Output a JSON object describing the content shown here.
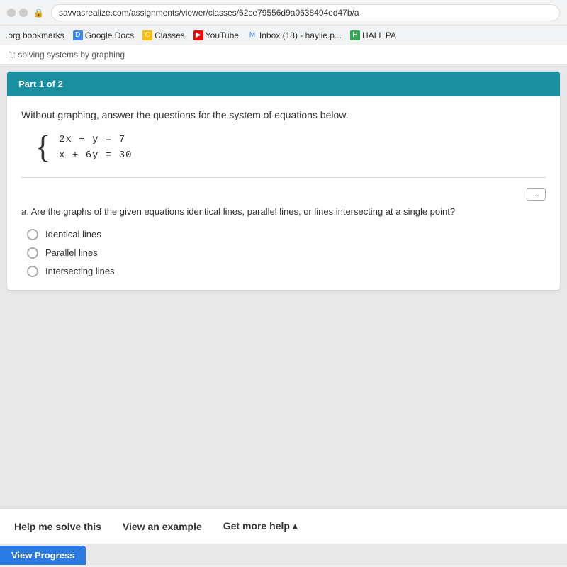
{
  "browser": {
    "url": "savvasrealize.com/assignments/viewer/classes/62ce79556d9a0638494ed47b/a",
    "lock_icon": "🔒"
  },
  "bookmarks": {
    "items": [
      {
        "label": ".org bookmarks",
        "icon": "",
        "icon_class": ""
      },
      {
        "label": "Google Docs",
        "icon": "D",
        "icon_class": "bm-docs"
      },
      {
        "label": "Classes",
        "icon": "C",
        "icon_class": "bm-classes"
      },
      {
        "label": "YouTube",
        "icon": "▶",
        "icon_class": "bm-yt"
      },
      {
        "label": "Inbox (18) - haylie.p...",
        "icon": "M",
        "icon_class": "bm-inbox"
      },
      {
        "label": "HALL PA",
        "icon": "H",
        "icon_class": "bm-hall"
      }
    ]
  },
  "breadcrumb": "1: solving systems by graphing",
  "card": {
    "header": "Part 1 of 2",
    "instruction": "Without graphing, answer the questions for the system of equations below.",
    "equations": [
      "2x + y  =  7",
      "x + 6y  =  30"
    ],
    "question_a": "a. Are the graphs of the given equations identical lines, parallel lines, or lines intersecting at a single point?",
    "options": [
      "Identical lines",
      "Parallel lines",
      "Intersecting lines"
    ],
    "more_button": "..."
  },
  "help_bar": {
    "help_me_solve": "Help me solve this",
    "view_example": "View an example",
    "get_more_help": "Get more help ▴"
  },
  "view_progress": "View Progress"
}
